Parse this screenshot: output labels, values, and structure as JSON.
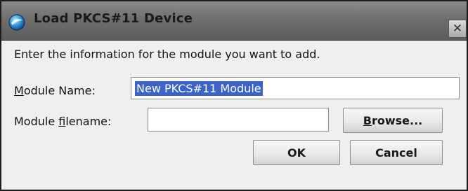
{
  "window": {
    "title": "Load PKCS#11 Device",
    "close_glyph": "✕",
    "icon": "app-globe-icon"
  },
  "dialog": {
    "intro": "Enter the information for the module you want to add.",
    "module_name": {
      "label_prefix": "",
      "label_access": "M",
      "label_rest": "odule Name:",
      "value": "New PKCS#11 Module"
    },
    "module_filename": {
      "label_prefix": "Module ",
      "label_access": "f",
      "label_rest": "ilename:",
      "value": ""
    },
    "browse": {
      "access": "B",
      "rest": "rowse..."
    },
    "ok_label": "OK",
    "cancel_label": "Cancel"
  },
  "colors": {
    "selection": "#3b63c9",
    "titlebar": "#6f6f6f",
    "dialog_bg": "#efefef"
  }
}
